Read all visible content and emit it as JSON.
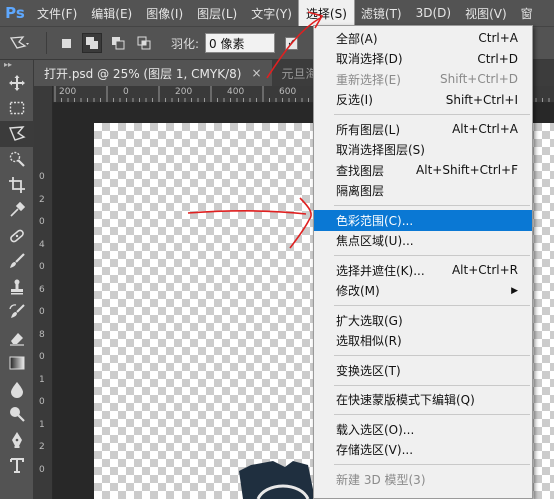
{
  "app": {
    "logo": "Ps"
  },
  "menubar": {
    "items": [
      "文件(F)",
      "编辑(E)",
      "图像(I)",
      "图层(L)",
      "文字(Y)",
      "选择(S)",
      "滤镜(T)",
      "3D(D)",
      "视图(V)",
      "窗"
    ],
    "active_index": 5
  },
  "options": {
    "feather_label": "羽化:",
    "feather_value": "0 像素",
    "check_mark": "✓"
  },
  "tabs": [
    {
      "label": "打开.psd @ 25% (图层 1, CMYK/8)",
      "close": "×",
      "active": true
    },
    {
      "label": "元旦海",
      "active": false
    }
  ],
  "ruler": {
    "h_ticks": [
      "200",
      "0",
      "200",
      "400",
      "600"
    ],
    "v_ticks": [
      "0",
      "2",
      "0",
      "4",
      "0",
      "6",
      "0",
      "8",
      "0",
      "1",
      "0",
      "1",
      "2",
      "0"
    ]
  },
  "select_menu": {
    "items": [
      {
        "label": "全部(A)",
        "shortcut": "Ctrl+A"
      },
      {
        "label": "取消选择(D)",
        "shortcut": "Ctrl+D"
      },
      {
        "label": "重新选择(E)",
        "shortcut": "Shift+Ctrl+D",
        "disabled": true
      },
      {
        "label": "反选(I)",
        "shortcut": "Shift+Ctrl+I"
      },
      {
        "sep": true
      },
      {
        "label": "所有图层(L)",
        "shortcut": "Alt+Ctrl+A"
      },
      {
        "label": "取消选择图层(S)",
        "shortcut": ""
      },
      {
        "label": "查找图层",
        "shortcut": "Alt+Shift+Ctrl+F"
      },
      {
        "label": "隔离图层",
        "shortcut": ""
      },
      {
        "sep": true
      },
      {
        "label": "色彩范围(C)...",
        "shortcut": "",
        "highlighted": true
      },
      {
        "label": "焦点区域(U)...",
        "shortcut": ""
      },
      {
        "sep": true
      },
      {
        "label": "选择并遮住(K)...",
        "shortcut": "Alt+Ctrl+R"
      },
      {
        "label": "修改(M)",
        "shortcut": "",
        "submenu": "▶"
      },
      {
        "sep": true
      },
      {
        "label": "扩大选取(G)",
        "shortcut": ""
      },
      {
        "label": "选取相似(R)",
        "shortcut": ""
      },
      {
        "sep": true
      },
      {
        "label": "变换选区(T)",
        "shortcut": ""
      },
      {
        "sep": true
      },
      {
        "label": "在快速蒙版模式下编辑(Q)",
        "shortcut": ""
      },
      {
        "sep": true
      },
      {
        "label": "载入选区(O)...",
        "shortcut": ""
      },
      {
        "label": "存储选区(V)...",
        "shortcut": ""
      },
      {
        "sep": true
      },
      {
        "label": "新建 3D 模型(3)",
        "shortcut": "",
        "disabled": true
      }
    ]
  },
  "colors": {
    "accent_highlight": "#0a78d4",
    "annotation_red": "#e02020",
    "ps_blue": "#5ea8ff"
  },
  "icons": {
    "toolbar": [
      "move-icon",
      "marquee-icon",
      "lasso-icon",
      "quick-select-icon",
      "crop-icon",
      "eyedropper-icon",
      "healing-icon",
      "brush-icon",
      "stamp-icon",
      "history-brush-icon",
      "eraser-icon",
      "gradient-icon",
      "blur-icon",
      "dodge-icon",
      "pen-icon",
      "text-icon"
    ]
  }
}
